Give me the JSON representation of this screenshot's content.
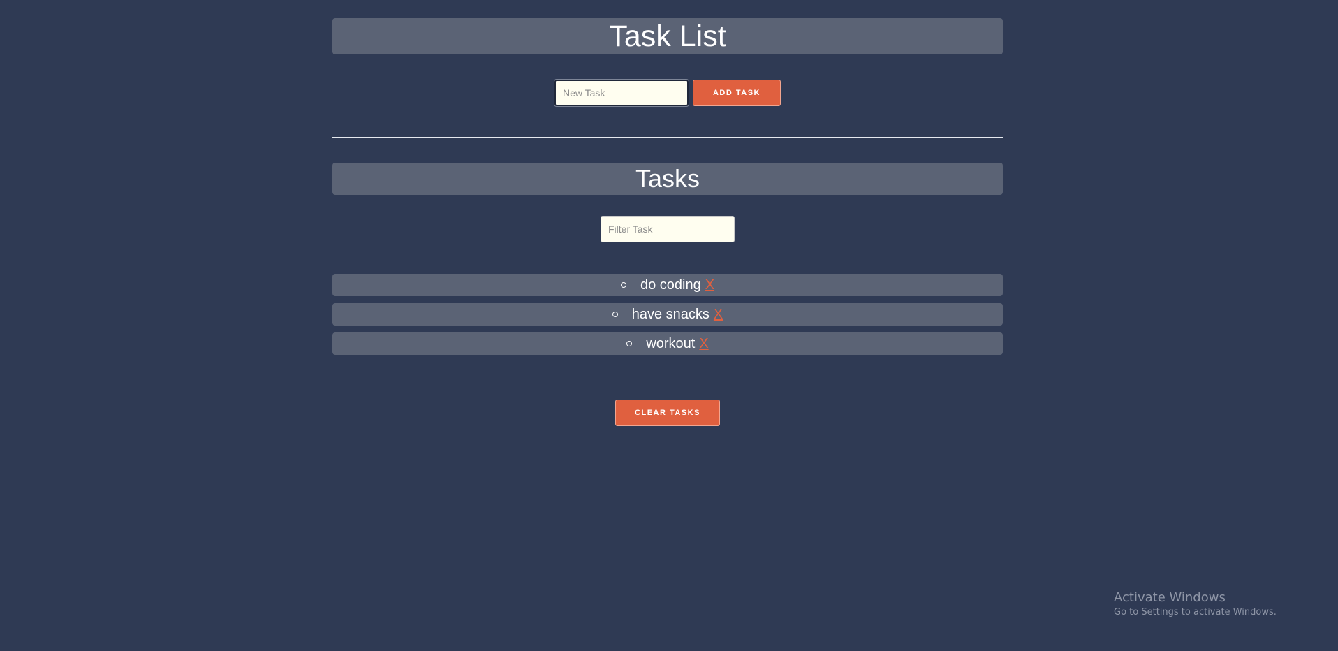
{
  "header": {
    "title": "Task List"
  },
  "add_form": {
    "new_task_placeholder": "New Task",
    "new_task_value": "",
    "add_button_label": "ADD TASK"
  },
  "tasks_section": {
    "title": "Tasks",
    "filter_placeholder": "Filter Task",
    "filter_value": "",
    "items": [
      {
        "text": "do coding",
        "delete_label": "X"
      },
      {
        "text": "have snacks",
        "delete_label": "X"
      },
      {
        "text": "workout",
        "delete_label": "X"
      }
    ],
    "clear_button_label": "CLEAR TASKS"
  },
  "watermark": {
    "title": "Activate Windows",
    "subtitle": "Go to Settings to activate Windows."
  },
  "colors": {
    "background": "#2f3a54",
    "panel": "#5b6375",
    "accent": "#e0603f",
    "input_bg": "#fffef0"
  },
  "icons": {
    "bullet": "circle-bullet-icon"
  }
}
